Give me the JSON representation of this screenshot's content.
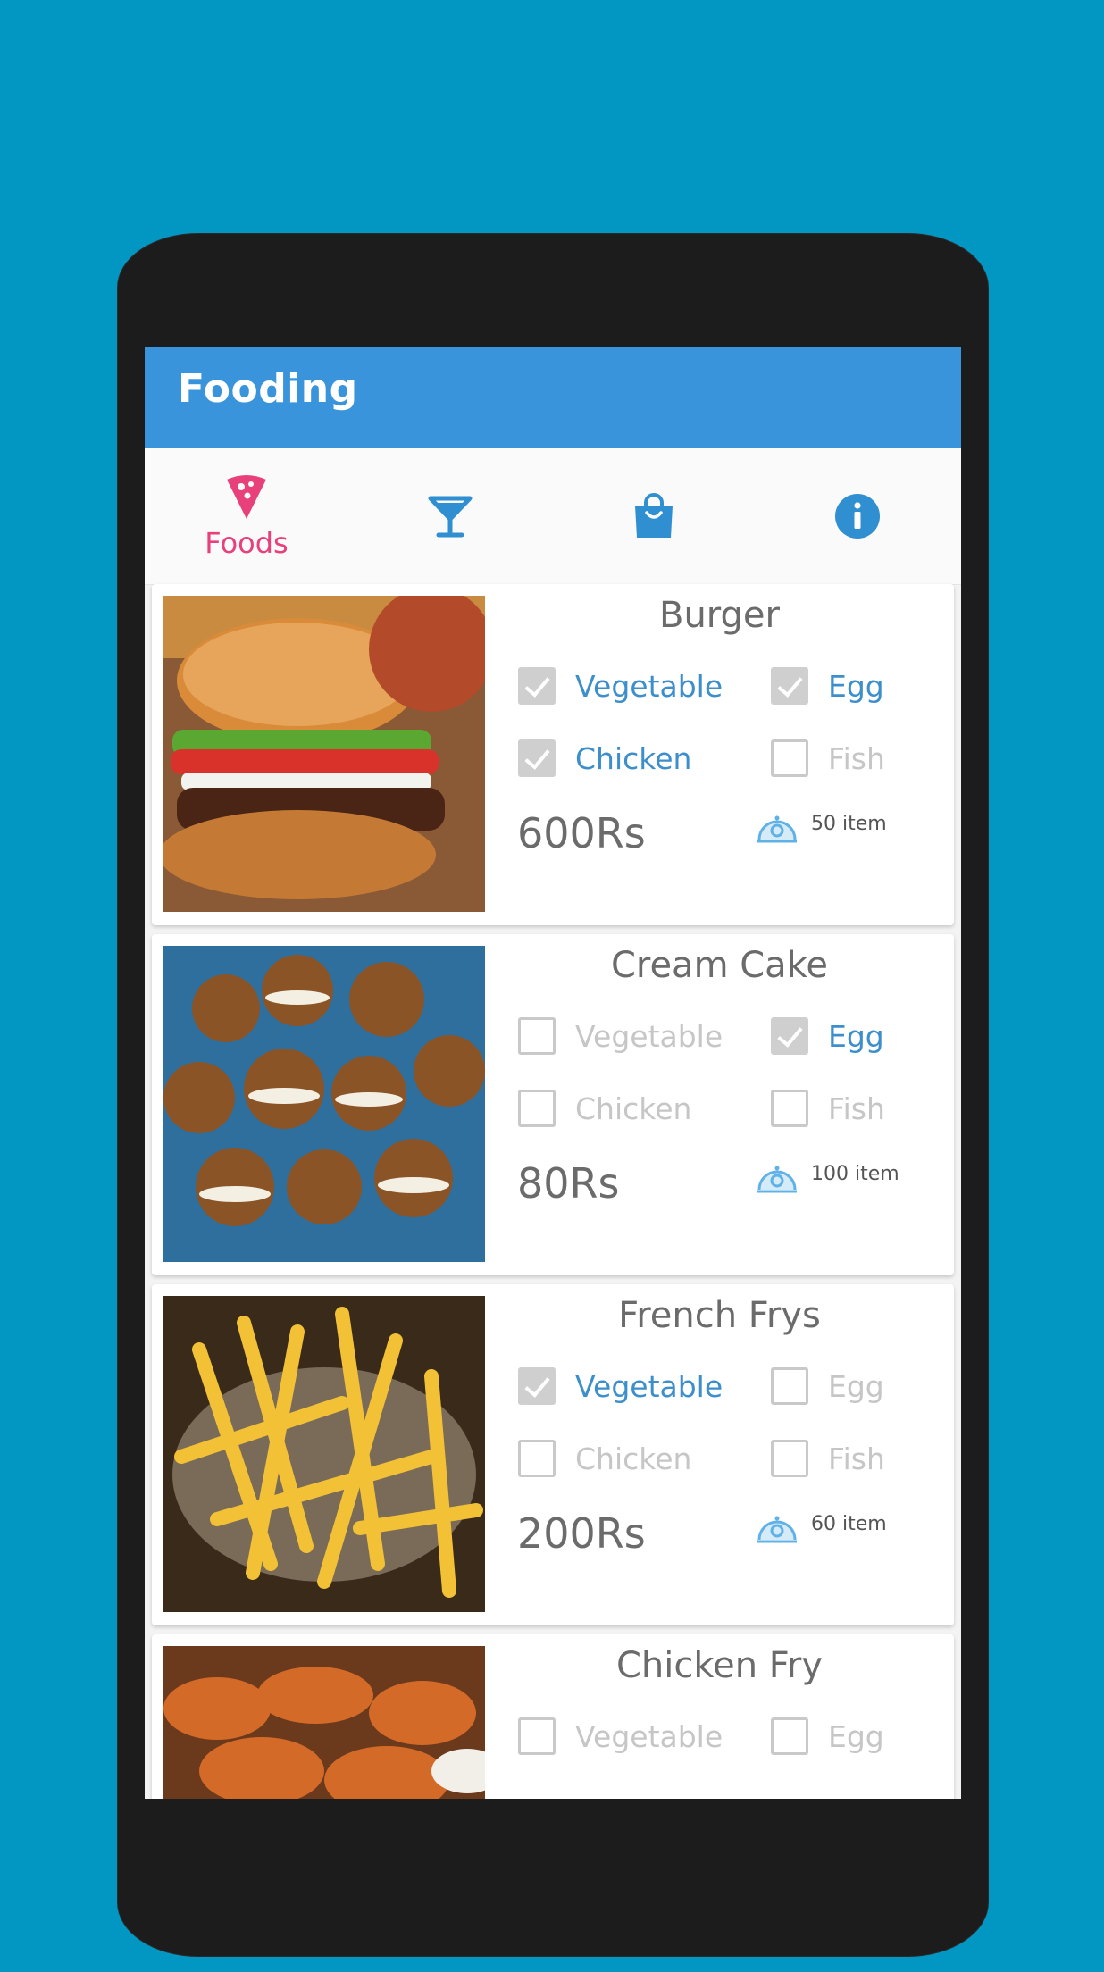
{
  "app": {
    "title": "Fooding"
  },
  "tabs": [
    {
      "label": "Foods",
      "icon": "pizza-slice-icon",
      "active": true
    },
    {
      "label": "",
      "icon": "cocktail-glass-icon",
      "active": false
    },
    {
      "label": "",
      "icon": "shopping-bag-icon",
      "active": false
    },
    {
      "label": "",
      "icon": "info-icon",
      "active": false
    }
  ],
  "colors": {
    "background": "#0297c3",
    "appbar": "#3994db",
    "accent": "#e8407b",
    "checked": "#3d8fcc"
  },
  "items": [
    {
      "name": "Burger",
      "image": "burger photo",
      "options": [
        {
          "label": "Vegetable",
          "checked": true
        },
        {
          "label": "Egg",
          "checked": true
        },
        {
          "label": "Chicken",
          "checked": true
        },
        {
          "label": "Fish",
          "checked": false
        }
      ],
      "price": "600Rs",
      "quantity": "50 item"
    },
    {
      "name": "Cream Cake",
      "image": "cream sandwich cookies photo",
      "options": [
        {
          "label": "Vegetable",
          "checked": false
        },
        {
          "label": "Egg",
          "checked": true
        },
        {
          "label": "Chicken",
          "checked": false
        },
        {
          "label": "Fish",
          "checked": false
        }
      ],
      "price": "80Rs",
      "quantity": "100 item"
    },
    {
      "name": "French Frys",
      "image": "french fries photo",
      "options": [
        {
          "label": "Vegetable",
          "checked": true
        },
        {
          "label": "Egg",
          "checked": false
        },
        {
          "label": "Chicken",
          "checked": false
        },
        {
          "label": "Fish",
          "checked": false
        }
      ],
      "price": "200Rs",
      "quantity": "60 item"
    },
    {
      "name": "Chicken Fry",
      "image": "fried chicken photo",
      "options": [
        {
          "label": "Vegetable",
          "checked": false
        },
        {
          "label": "Egg",
          "checked": false
        }
      ],
      "price": "",
      "quantity": ""
    }
  ]
}
